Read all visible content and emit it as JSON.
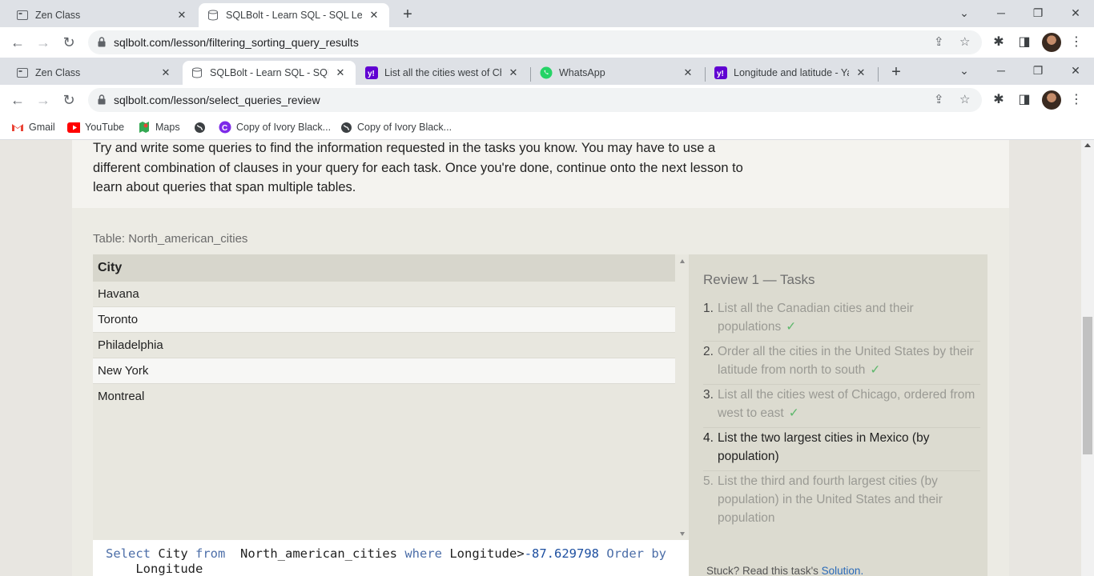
{
  "outer_window": {
    "tabs": [
      {
        "title": "Zen Class",
        "icon": "zen-class-icon",
        "active": false
      },
      {
        "title": "SQLBolt - Learn SQL - SQL Lesson",
        "icon": "sqlbolt-icon",
        "active": true
      }
    ],
    "url": "sqlbolt.com/lesson/filtering_sorting_query_results"
  },
  "inner_window": {
    "tabs": [
      {
        "title": "Zen Class",
        "icon": "zen-class-icon",
        "active": false
      },
      {
        "title": "SQLBolt - Learn SQL - SQL Re",
        "icon": "sqlbolt-icon",
        "active": true
      },
      {
        "title": "List all the cities west of Chic",
        "icon": "yahoo-icon",
        "active": false
      },
      {
        "title": "WhatsApp",
        "icon": "whatsapp-icon",
        "active": false
      },
      {
        "title": "Longitude and latitude - Yah",
        "icon": "yahoo-icon",
        "active": false
      }
    ],
    "url": "sqlbolt.com/lesson/select_queries_review"
  },
  "bookmarks": [
    {
      "label": "Gmail",
      "icon": "gmail-icon"
    },
    {
      "label": "YouTube",
      "icon": "youtube-icon"
    },
    {
      "label": "Maps",
      "icon": "maps-icon"
    },
    {
      "label": "",
      "icon": "globe-icon"
    },
    {
      "label": "Copy of Ivory Black...",
      "icon": "canva-icon"
    },
    {
      "label": "Copy of Ivory Black...",
      "icon": "globe-icon"
    }
  ],
  "lesson": {
    "intro_text": "Try and write some queries to find the information requested in the tasks you know. You may have to use a different combination of clauses in your query for each task. Once you're done, continue onto the next lesson to learn about queries that span multiple tables.",
    "table_label": "Table: North_american_cities",
    "results": {
      "column": "City",
      "rows": [
        "Havana",
        "Toronto",
        "Philadelphia",
        "New York",
        "Montreal"
      ]
    },
    "query": {
      "kw_select": "Select",
      "col": "City",
      "kw_from": "from",
      "table": "North_american_cities",
      "kw_where": "where",
      "cond_col": "Longitude",
      "op": ">",
      "value": "-87.629798",
      "kw_order": "Order by",
      "order_col": "Longitude"
    },
    "tasks_title": "Review 1 — Tasks",
    "tasks": [
      {
        "num": "1.",
        "text": "List all the Canadian cities and their populations",
        "done": true
      },
      {
        "num": "2.",
        "text": "Order all the cities in the United States by their latitude from north to south",
        "done": true
      },
      {
        "num": "3.",
        "text": "List all the cities west of Chicago, ordered from west to east",
        "done": true
      },
      {
        "num": "4.",
        "text": "List the two largest cities in Mexico (by population)",
        "done": false
      },
      {
        "num": "5.",
        "text": "List the third and fourth largest cities (by population) in the United States and their population",
        "done": false
      }
    ],
    "check_mark": "✓",
    "stuck_text": "Stuck? Read this task's ",
    "solution_link": "Solution."
  },
  "colors": {
    "accent_link": "#2a6ab8",
    "check_green": "#5fb86d",
    "sql_keyword": "#4c6ea8"
  }
}
